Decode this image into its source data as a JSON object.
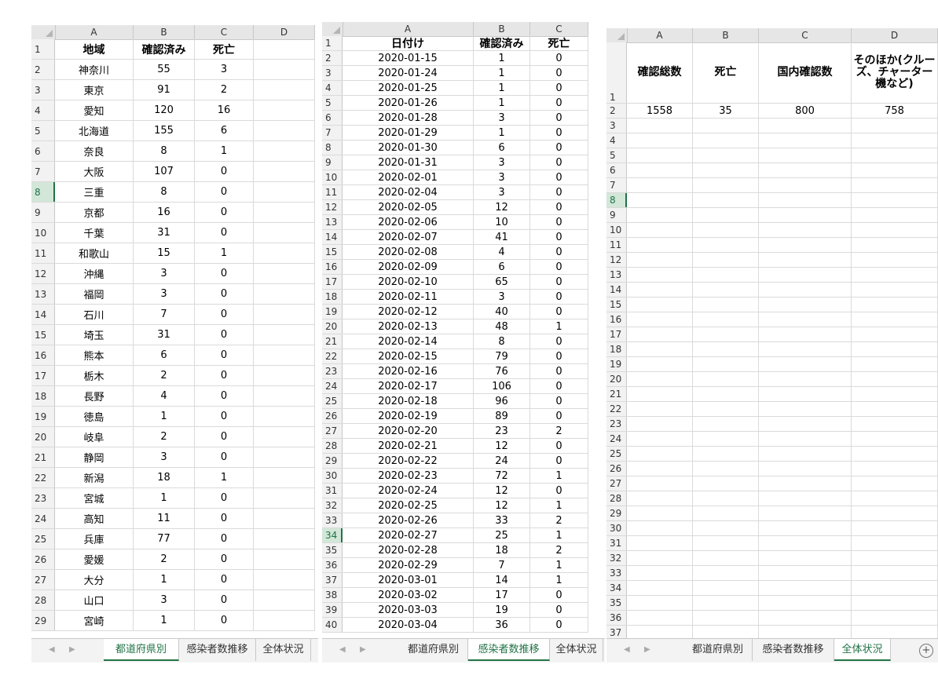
{
  "panel1": {
    "columns": [
      "A",
      "B",
      "C",
      "D"
    ],
    "header": [
      "地域",
      "確認済み",
      "死亡"
    ],
    "rows": [
      [
        "神奈川",
        "55",
        "3"
      ],
      [
        "東京",
        "91",
        "2"
      ],
      [
        "愛知",
        "120",
        "16"
      ],
      [
        "北海道",
        "155",
        "6"
      ],
      [
        "奈良",
        "8",
        "1"
      ],
      [
        "大阪",
        "107",
        "0"
      ],
      [
        "三重",
        "8",
        "0"
      ],
      [
        "京都",
        "16",
        "0"
      ],
      [
        "千葉",
        "31",
        "0"
      ],
      [
        "和歌山",
        "15",
        "1"
      ],
      [
        "沖縄",
        "3",
        "0"
      ],
      [
        "福岡",
        "3",
        "0"
      ],
      [
        "石川",
        "7",
        "0"
      ],
      [
        "埼玉",
        "31",
        "0"
      ],
      [
        "熊本",
        "6",
        "0"
      ],
      [
        "栃木",
        "2",
        "0"
      ],
      [
        "長野",
        "4",
        "0"
      ],
      [
        "徳島",
        "1",
        "0"
      ],
      [
        "岐阜",
        "2",
        "0"
      ],
      [
        "静岡",
        "3",
        "0"
      ],
      [
        "新潟",
        "18",
        "1"
      ],
      [
        "宮城",
        "1",
        "0"
      ],
      [
        "高知",
        "11",
        "0"
      ],
      [
        "兵庫",
        "77",
        "0"
      ],
      [
        "愛媛",
        "2",
        "0"
      ],
      [
        "大分",
        "1",
        "0"
      ],
      [
        "山口",
        "3",
        "0"
      ],
      [
        "宮崎",
        "1",
        "0"
      ]
    ],
    "selected_row": "8",
    "tabs": [
      "都道府県別",
      "感染者数推移",
      "全体状況"
    ],
    "active_tab": 0
  },
  "panel2": {
    "columns": [
      "A",
      "B",
      "C"
    ],
    "header": [
      "日付け",
      "確認済み",
      "死亡"
    ],
    "rows": [
      [
        "2020-01-15",
        "1",
        "0"
      ],
      [
        "2020-01-24",
        "1",
        "0"
      ],
      [
        "2020-01-25",
        "1",
        "0"
      ],
      [
        "2020-01-26",
        "1",
        "0"
      ],
      [
        "2020-01-28",
        "3",
        "0"
      ],
      [
        "2020-01-29",
        "1",
        "0"
      ],
      [
        "2020-01-30",
        "6",
        "0"
      ],
      [
        "2020-01-31",
        "3",
        "0"
      ],
      [
        "2020-02-01",
        "3",
        "0"
      ],
      [
        "2020-02-04",
        "3",
        "0"
      ],
      [
        "2020-02-05",
        "12",
        "0"
      ],
      [
        "2020-02-06",
        "10",
        "0"
      ],
      [
        "2020-02-07",
        "41",
        "0"
      ],
      [
        "2020-02-08",
        "4",
        "0"
      ],
      [
        "2020-02-09",
        "6",
        "0"
      ],
      [
        "2020-02-10",
        "65",
        "0"
      ],
      [
        "2020-02-11",
        "3",
        "0"
      ],
      [
        "2020-02-12",
        "40",
        "0"
      ],
      [
        "2020-02-13",
        "48",
        "1"
      ],
      [
        "2020-02-14",
        "8",
        "0"
      ],
      [
        "2020-02-15",
        "79",
        "0"
      ],
      [
        "2020-02-16",
        "76",
        "0"
      ],
      [
        "2020-02-17",
        "106",
        "0"
      ],
      [
        "2020-02-18",
        "96",
        "0"
      ],
      [
        "2020-02-19",
        "89",
        "0"
      ],
      [
        "2020-02-20",
        "23",
        "2"
      ],
      [
        "2020-02-21",
        "12",
        "0"
      ],
      [
        "2020-02-22",
        "24",
        "0"
      ],
      [
        "2020-02-23",
        "72",
        "1"
      ],
      [
        "2020-02-24",
        "12",
        "0"
      ],
      [
        "2020-02-25",
        "12",
        "1"
      ],
      [
        "2020-02-26",
        "33",
        "2"
      ],
      [
        "2020-02-27",
        "25",
        "1"
      ],
      [
        "2020-02-28",
        "18",
        "2"
      ],
      [
        "2020-02-29",
        "7",
        "1"
      ],
      [
        "2020-03-01",
        "14",
        "1"
      ],
      [
        "2020-03-02",
        "17",
        "0"
      ],
      [
        "2020-03-03",
        "19",
        "0"
      ],
      [
        "2020-03-04",
        "36",
        "0"
      ]
    ],
    "selected_row": "34",
    "tabs": [
      "都道府県別",
      "感染者数推移",
      "全体状況"
    ],
    "active_tab": 1
  },
  "panel3": {
    "columns": [
      "A",
      "B",
      "C",
      "D"
    ],
    "header": [
      "確認総数",
      "死亡",
      "国内確認数",
      "そのほか(クルーズ、チャーター機など)"
    ],
    "values": [
      "1558",
      "35",
      "800",
      "758"
    ],
    "selected_row": "8",
    "tabs": [
      "都道府県別",
      "感染者数推移",
      "全体状況"
    ],
    "active_tab": 2
  },
  "icons": {
    "scroll_left": "triangle-left-icon",
    "scroll_right": "triangle-right-icon",
    "add_sheet": "plus-circle-icon"
  },
  "colors": {
    "accent": "#217346",
    "selected_header_bg": "#d3e7d9",
    "header_bg": "#e6e6e6"
  }
}
